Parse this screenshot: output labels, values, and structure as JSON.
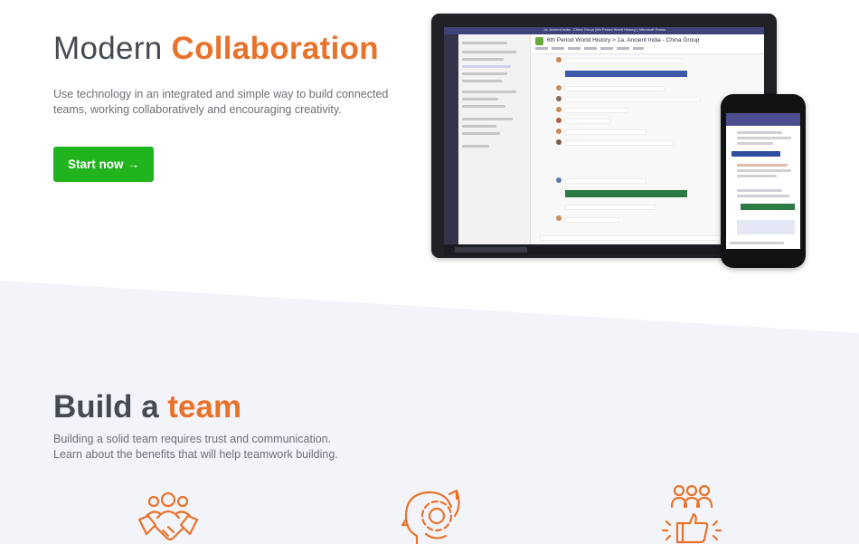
{
  "hero": {
    "title_plain": "Modern ",
    "title_accent": "Collaboration",
    "description": "Use technology in an integrated and simple way to build connected teams, working collaboratively and encouraging creativity.",
    "cta_label": "Start now",
    "cta_arrow": "→"
  },
  "devices": {
    "tablet_header": "6th Period World History > 1a. Ancient India - China Group",
    "tablet_topbar": "1a. Ancient India - China Group (6th Period World History) | Microsoft Teams"
  },
  "team": {
    "title_plain": "Build a ",
    "title_accent": "team",
    "description": "Building a solid team requires trust and communication. Learn about the benefits that will help teamwork building."
  },
  "icons": [
    "handshake-team-icon",
    "mind-gears-icon",
    "team-thumbs-up-icon"
  ],
  "colors": {
    "accent": "#e8722a",
    "cta": "#22b41e",
    "heading": "#444a52",
    "band": "#f3f4fa"
  }
}
